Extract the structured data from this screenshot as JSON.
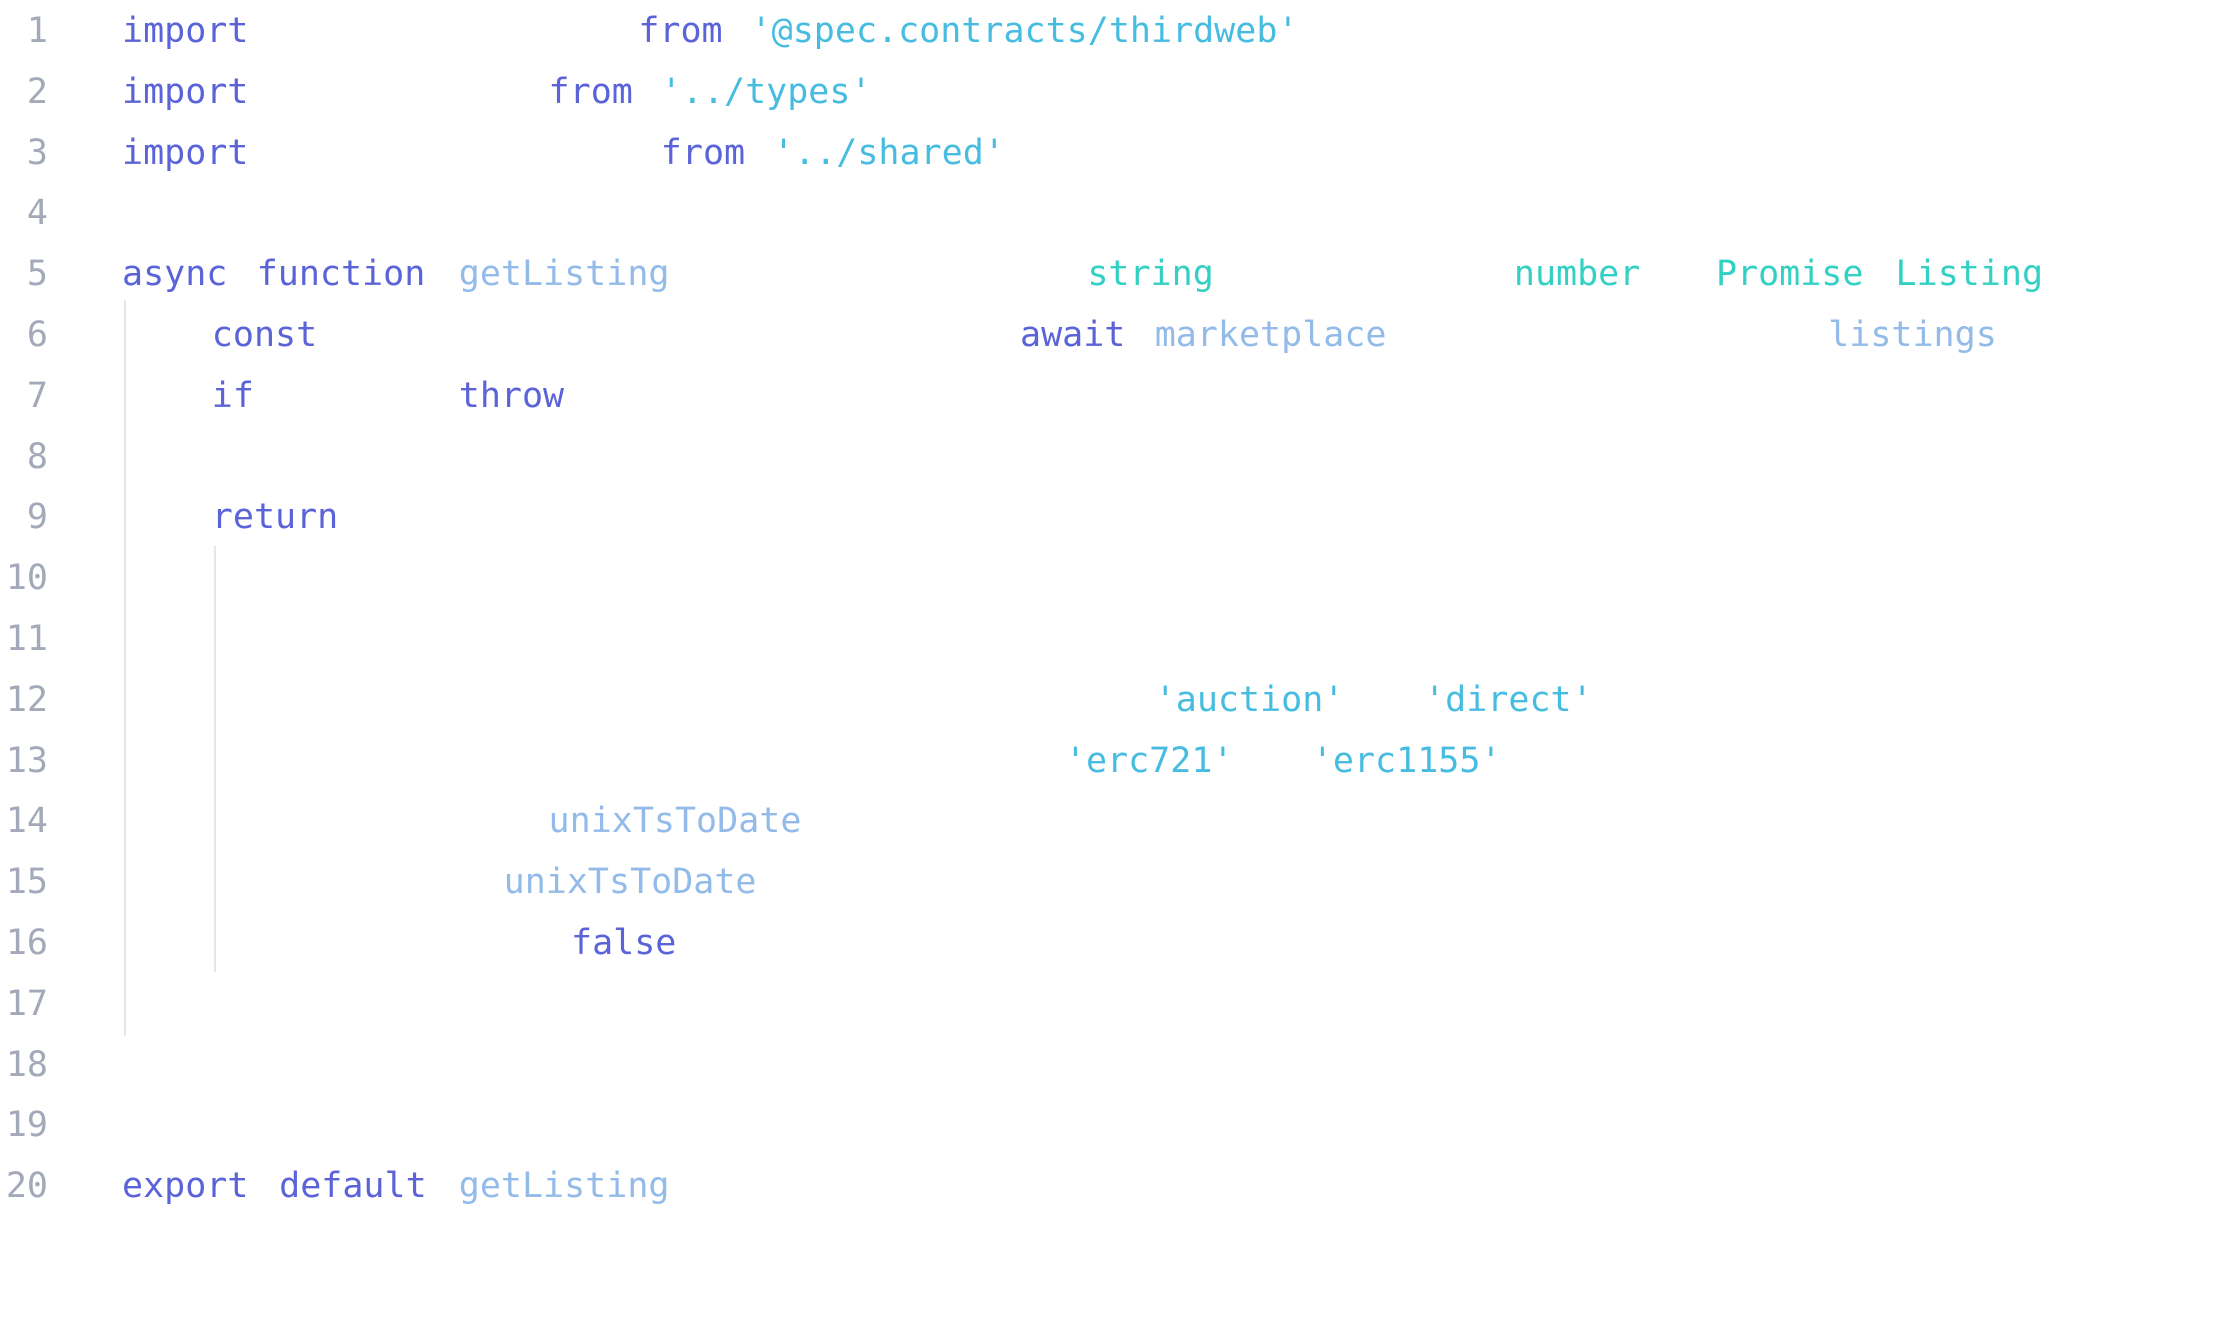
{
  "colors": {
    "keyword": "#5b63d9",
    "string": "#46bde0",
    "identifier": "#93bbea",
    "type": "#33d0c4",
    "line_number": "#a3a9b8",
    "indent_guide": "#e4e6ec",
    "background": "#ffffff"
  },
  "lines": [
    {
      "number": "1",
      "tokens": [
        {
          "text": "import",
          "kind": "kw",
          "col": 0
        },
        {
          "text": "from",
          "kind": "kw",
          "col": 23
        },
        {
          "text": "'@spec.contracts/thirdweb'",
          "kind": "str",
          "col": 28
        }
      ]
    },
    {
      "number": "2",
      "tokens": [
        {
          "text": "import",
          "kind": "kw",
          "col": 0
        },
        {
          "text": "from",
          "kind": "kw",
          "col": 19
        },
        {
          "text": "'../types'",
          "kind": "str",
          "col": 24
        }
      ]
    },
    {
      "number": "3",
      "tokens": [
        {
          "text": "import",
          "kind": "kw",
          "col": 0
        },
        {
          "text": "from",
          "kind": "kw",
          "col": 24
        },
        {
          "text": "'../shared'",
          "kind": "str",
          "col": 29
        }
      ]
    },
    {
      "number": "4",
      "tokens": []
    },
    {
      "number": "5",
      "tokens": [
        {
          "text": "async",
          "kind": "kw",
          "col": 0
        },
        {
          "text": "function",
          "kind": "kw",
          "col": 6
        },
        {
          "text": "getListing",
          "kind": "fn",
          "col": 15
        },
        {
          "text": "string",
          "kind": "ty",
          "col": 43
        },
        {
          "text": "number",
          "kind": "ty",
          "col": 62
        },
        {
          "text": "Promise",
          "kind": "ty",
          "col": 71
        },
        {
          "text": "Listing",
          "kind": "ty",
          "col": 79
        }
      ]
    },
    {
      "number": "6",
      "tokens": [
        {
          "text": "const",
          "kind": "kw",
          "col": 4
        },
        {
          "text": "await",
          "kind": "kw",
          "col": 40
        },
        {
          "text": "marketplace",
          "kind": "fn",
          "col": 46
        },
        {
          "text": "listings",
          "kind": "fn",
          "col": 76
        }
      ]
    },
    {
      "number": "7",
      "tokens": [
        {
          "text": "if",
          "kind": "kw",
          "col": 4
        },
        {
          "text": "throw",
          "kind": "kw",
          "col": 15
        }
      ]
    },
    {
      "number": "8",
      "tokens": []
    },
    {
      "number": "9",
      "tokens": [
        {
          "text": "return",
          "kind": "kw",
          "col": 4
        }
      ]
    },
    {
      "number": "10",
      "tokens": []
    },
    {
      "number": "11",
      "tokens": []
    },
    {
      "number": "12",
      "tokens": [
        {
          "text": "'auction'",
          "kind": "str",
          "col": 46
        },
        {
          "text": "'direct'",
          "kind": "str",
          "col": 58
        }
      ]
    },
    {
      "number": "13",
      "tokens": [
        {
          "text": "'erc721'",
          "kind": "str",
          "col": 42
        },
        {
          "text": "'erc1155'",
          "kind": "str",
          "col": 53
        }
      ]
    },
    {
      "number": "14",
      "tokens": [
        {
          "text": "unixTsToDate",
          "kind": "fn",
          "col": 19
        }
      ]
    },
    {
      "number": "15",
      "tokens": [
        {
          "text": "unixTsToDate",
          "kind": "fn",
          "col": 17
        }
      ]
    },
    {
      "number": "16",
      "tokens": [
        {
          "text": "false",
          "kind": "kw",
          "col": 20
        }
      ]
    },
    {
      "number": "17",
      "tokens": []
    },
    {
      "number": "18",
      "tokens": []
    },
    {
      "number": "19",
      "tokens": []
    },
    {
      "number": "20",
      "tokens": [
        {
          "text": "export",
          "kind": "kw",
          "col": 0
        },
        {
          "text": "default",
          "kind": "kw",
          "col": 7
        },
        {
          "text": "getListing",
          "kind": "fn",
          "col": 15
        }
      ]
    }
  ]
}
